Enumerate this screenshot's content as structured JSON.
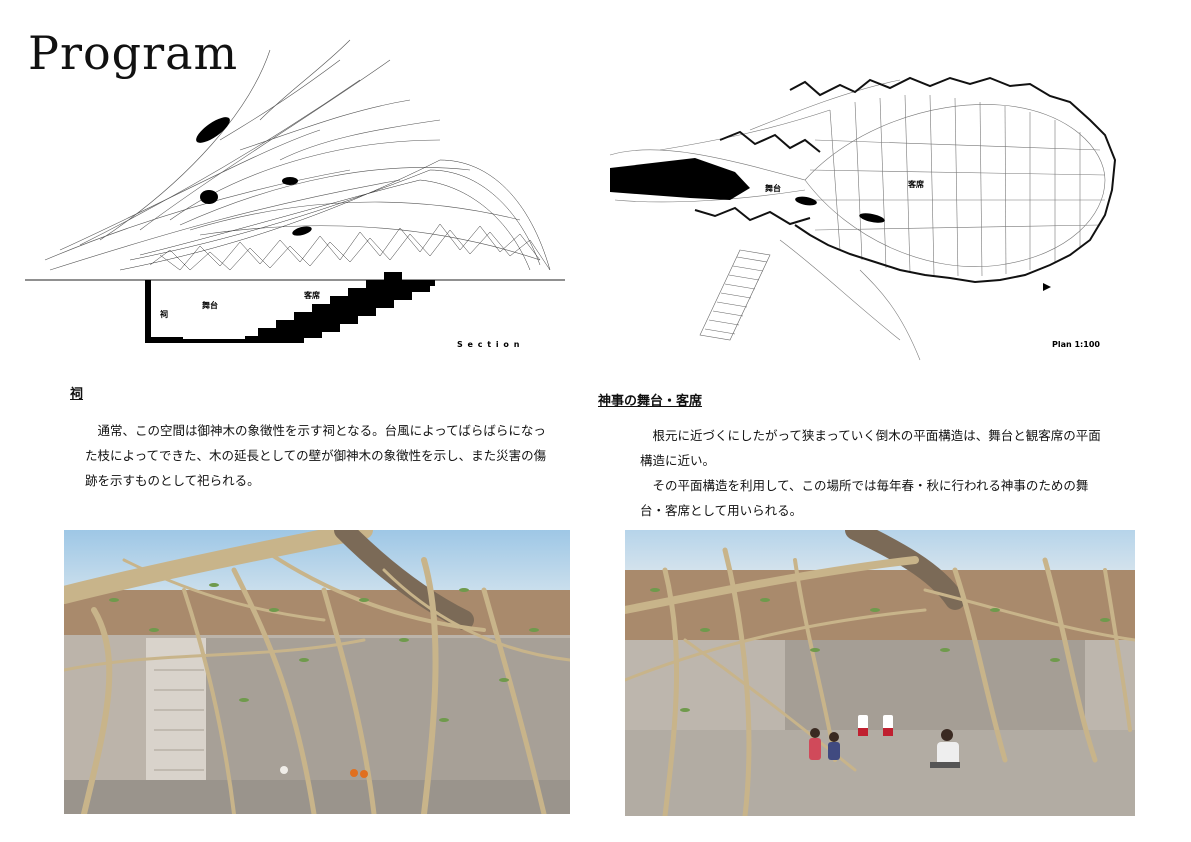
{
  "page": {
    "title": "Program"
  },
  "section_drawing": {
    "label_shrine": "祠",
    "label_stage": "舞台",
    "label_seats": "客席",
    "caption": "S e c t i o n"
  },
  "plan_drawing": {
    "label_stage": "舞台",
    "label_seats": "客席",
    "caption": "Plan 1:100"
  },
  "left_text": {
    "heading": "祠",
    "paragraphs": [
      "通常、この空間は御神木の象徴性を示す祠となる。台風によってばらばらになった枝によってできた、木の延長としての壁が御神木の象徴性を示し、また災害の傷跡を示すものとして祀られる。"
    ]
  },
  "right_text": {
    "heading": "神事の舞台・客席",
    "paragraphs": [
      "根元に近づくにしたがって狭まっていく倒木の平面構造は、舞台と観客席の平面構造に近い。",
      "その平面構造を利用して、この場所では毎年春・秋に行われる神事のための舞台・客席として用いられる。"
    ]
  },
  "colors": {
    "ink": "#111111",
    "ground": "#bdb6ad",
    "branch": "#c9b58c",
    "leaf": "#6f9a4c",
    "sky": "#a9cde8"
  }
}
